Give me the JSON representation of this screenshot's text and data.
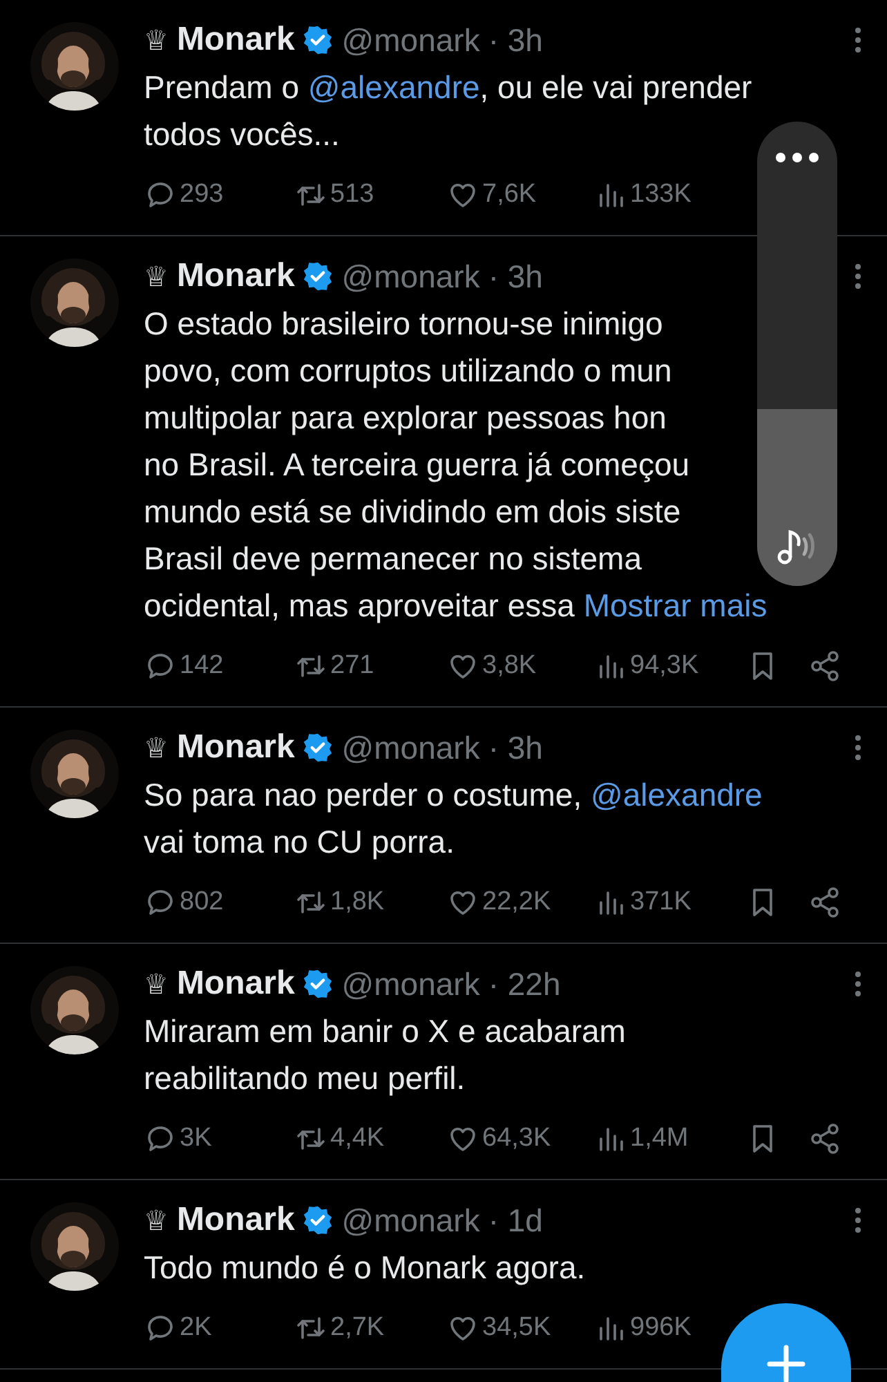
{
  "tweets": [
    {
      "name_prefix": "♕",
      "author": "Monark",
      "verified": true,
      "handle": "@monark",
      "time": "· 3h",
      "menu": true,
      "body": [
        {
          "parts": [
            {
              "kind": "text",
              "text": "Prendam o "
            },
            {
              "kind": "mention",
              "text": "@alexandre"
            },
            {
              "kind": "text",
              "text": ", ou ele vai prender"
            }
          ]
        },
        {
          "parts": [
            {
              "kind": "text",
              "text": "todos vocês..."
            }
          ]
        }
      ],
      "replies": "293",
      "reposts": "513",
      "likes": "7,6K",
      "views": "133K"
    },
    {
      "name_prefix": "♕",
      "author": "Monark",
      "verified": true,
      "handle": "@monark",
      "time": "· 3h",
      "menu": true,
      "body": [
        {
          "parts": [
            {
              "kind": "text",
              "text": "O estado brasileiro tornou-se inimigo"
            }
          ]
        },
        {
          "parts": [
            {
              "kind": "text",
              "text": "povo, com corruptos utilizando o mun"
            }
          ]
        },
        {
          "parts": [
            {
              "kind": "text",
              "text": "multipolar para explorar pessoas hon"
            }
          ]
        },
        {
          "parts": [
            {
              "kind": "text",
              "text": "no Brasil. A terceira guerra já começou"
            }
          ]
        },
        {
          "parts": [
            {
              "kind": "text",
              "text": "mundo está se dividindo em dois siste"
            }
          ]
        },
        {
          "parts": [
            {
              "kind": "text",
              "text": "Brasil deve permanecer no sistema"
            }
          ]
        },
        {
          "parts": [
            {
              "kind": "text",
              "text": "ocidental, mas aproveitar essa "
            },
            {
              "kind": "mention",
              "text": "Mostrar mais"
            }
          ]
        }
      ],
      "replies": "142",
      "reposts": "271",
      "likes": "3,8K",
      "views": "94,3K",
      "extra_actions": [
        {
          "kind": "bookmark"
        },
        {
          "kind": "share"
        }
      ]
    },
    {
      "name_prefix": "♕",
      "author": "Monark",
      "verified": true,
      "handle": "@monark",
      "time": "· 3h",
      "menu": true,
      "body": [
        {
          "parts": [
            {
              "kind": "text",
              "text": "So para nao perder o costume, "
            },
            {
              "kind": "mention",
              "text": "@alexandre"
            }
          ]
        },
        {
          "parts": [
            {
              "kind": "text",
              "text": "vai toma no CU porra."
            }
          ]
        }
      ],
      "replies": "802",
      "reposts": "1,8K",
      "likes": "22,2K",
      "views": "371K",
      "extra_actions": [
        {
          "kind": "bookmark"
        },
        {
          "kind": "share"
        }
      ]
    },
    {
      "name_prefix": "♕",
      "author": "Monark",
      "verified": true,
      "handle": "@monark",
      "time": "· 22h",
      "menu": true,
      "body": [
        {
          "parts": [
            {
              "kind": "text",
              "text": "Miraram em banir o X e acabaram"
            }
          ]
        },
        {
          "parts": [
            {
              "kind": "text",
              "text": "reabilitando meu perfil."
            }
          ]
        }
      ],
      "replies": "3K",
      "reposts": "4,4K",
      "likes": "64,3K",
      "views": "1,4M",
      "extra_actions": [
        {
          "kind": "bookmark"
        },
        {
          "kind": "share"
        }
      ]
    },
    {
      "name_prefix": "♕",
      "author": "Monark",
      "verified": true,
      "handle": "@monark",
      "time": "· 1d",
      "menu": true,
      "body": [
        {
          "parts": [
            {
              "kind": "text",
              "text": "Todo mundo é o Monark agora."
            }
          ]
        }
      ],
      "replies": "2K",
      "reposts": "2,7K",
      "likes": "34,5K",
      "views": "996K"
    }
  ],
  "volume": {
    "level": 0.38
  },
  "compose_button": {
    "kind": "plus"
  }
}
